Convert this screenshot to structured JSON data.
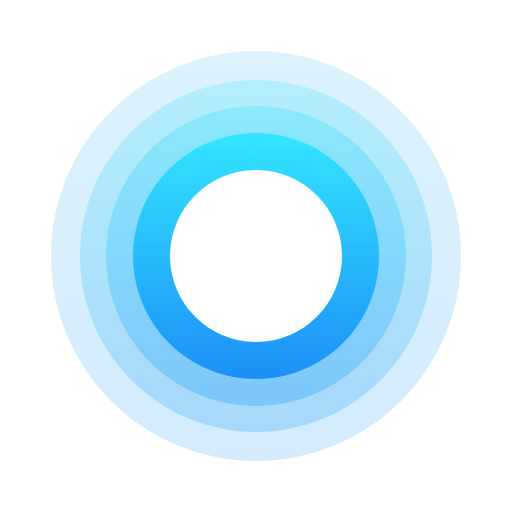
{
  "icon": {
    "name": "concentric-rings-logo-icon",
    "colors": {
      "background": "#ffffff",
      "outer_ring": "#d8f0fd",
      "middle_ring_top": "#a8ecfb",
      "middle_ring_bottom": "#8fd0fb",
      "inner_ring_top": "#8ce6fa",
      "inner_ring_bottom": "#6fc0f8",
      "core_top": "#34e4fd",
      "core_bottom": "#1f93f7",
      "center": "#ffffff"
    }
  }
}
